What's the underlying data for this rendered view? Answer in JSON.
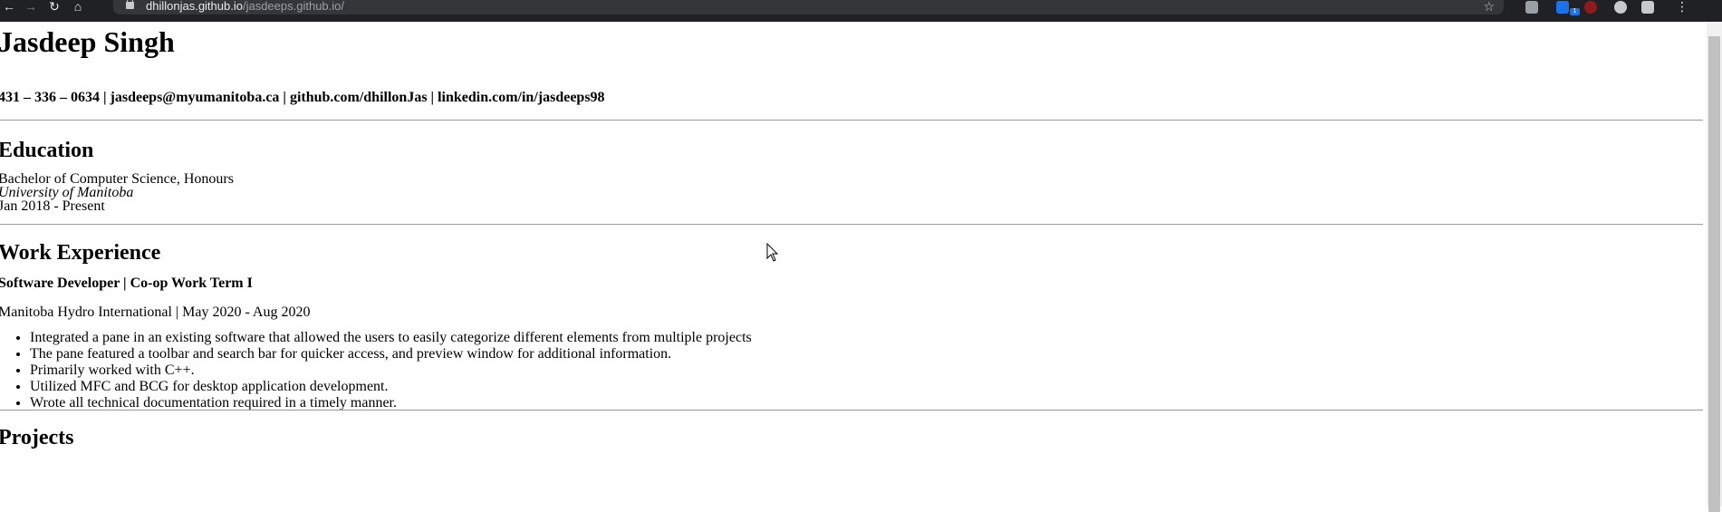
{
  "browser": {
    "url_host": "dhillonjas.github.io",
    "url_path": "/jasdeeps.github.io/",
    "back_icon": "back-arrow-icon",
    "forward_icon": "forward-arrow-icon",
    "reload_icon": "reload-icon",
    "home_icon": "home-icon",
    "bookmark_icon": "star-icon",
    "extensions": [
      {
        "name": "media-extension-icon",
        "color": "#9aa0a6"
      },
      {
        "name": "blue-extension-icon",
        "color": "#1a73e8"
      },
      {
        "name": "ublock-icon",
        "color": "#8e1b1b"
      },
      {
        "name": "circle-extension-icon",
        "color": "#c7c9cc"
      },
      {
        "name": "puzzle-icon",
        "color": "#c7c9cc"
      },
      {
        "name": "profile-avatar-icon",
        "color": "#5f6368"
      }
    ],
    "extension_badge": "1"
  },
  "resume": {
    "name": "Jasdeep Singh",
    "contact": "431 – 336 – 0634 | jasdeeps@myumanitoba.ca | github.com/dhillonJas | linkedin.com/in/jasdeeps98",
    "education": {
      "heading": "Education",
      "degree": "Bachelor of Computer Science, Honours",
      "school": "University of Manitoba",
      "dates": "Jan 2018 - Present"
    },
    "work": {
      "heading": "Work Experience",
      "job_title": "Software Developer | Co-op Work Term I",
      "employer_dates": "Manitoba Hydro International | May 2020 - Aug 2020",
      "bullets": [
        "Integrated a pane in an existing software that allowed the users to easily categorize different elements from multiple projects",
        "The pane featured a toolbar and search bar for quicker access, and preview window for additional information.",
        "Primarily worked with C++.",
        "Utilized MFC and BCG for desktop application development.",
        "Wrote all technical documentation required in a timely manner."
      ]
    },
    "projects": {
      "heading": "Projects"
    }
  },
  "colors": {
    "chrome_bg": "#202124",
    "omnibox_bg": "#35363a",
    "rule": "#9a9a9a"
  }
}
